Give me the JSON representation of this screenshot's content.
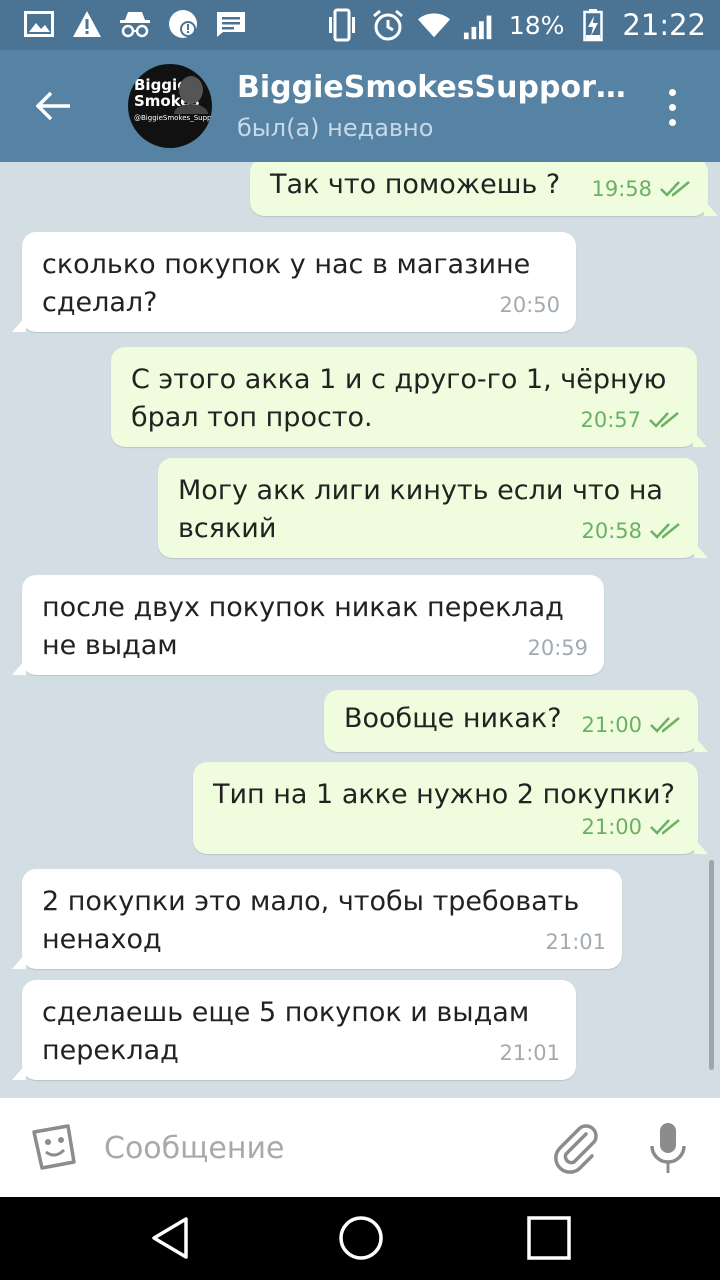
{
  "status_bar": {
    "battery": "18%",
    "time": "21:22",
    "icons": [
      "image-icon",
      "warning-icon",
      "incognito-icon",
      "sync-alert-icon",
      "message-icon",
      "vibrate-icon",
      "alarm-icon",
      "wifi-icon",
      "signal-icon",
      "battery-charging-icon"
    ]
  },
  "header": {
    "title": "BiggieSmokesSupport…",
    "status": "был(а) недавно",
    "avatar": {
      "line1": "Biggie",
      "line2": "Smokes",
      "line3": "@BiggieSmokes_Support"
    },
    "back_icon": "arrow-left-icon",
    "menu_icon": "more-vertical-icon"
  },
  "messages": [
    {
      "dir": "out",
      "text": "Так что поможешь ?",
      "time": "19:58",
      "read": true
    },
    {
      "dir": "in",
      "text": "сколько покупок у нас в магазине сделал?",
      "time": "20:50"
    },
    {
      "dir": "out",
      "text": "С этого акка 1 и с друго-го 1, чёрную брал топ просто.",
      "time": "20:57",
      "read": true
    },
    {
      "dir": "out",
      "text": "Могу акк лиги кинуть если что на всякий",
      "time": "20:58",
      "read": true
    },
    {
      "dir": "in",
      "text": "после двух покупок никак переклад не выдам",
      "time": "20:59"
    },
    {
      "dir": "out",
      "text": "Вообще никак?",
      "time": "21:00",
      "read": true
    },
    {
      "dir": "out",
      "text": "Тип на 1 акке нужно 2 покупки?",
      "time": "21:00",
      "read": true
    },
    {
      "dir": "in",
      "text": "2 покупки это мало, чтобы требовать ненаход",
      "time": "21:01"
    },
    {
      "dir": "in",
      "text": "сделаешь еще 5 покупок и выдам переклад",
      "time": "21:01"
    }
  ],
  "input": {
    "placeholder": "Сообщение",
    "value": ""
  },
  "colors": {
    "status_bar": "#4a7394",
    "header": "#5682a3",
    "outgoing_bubble": "#effdde",
    "incoming_bubble": "#ffffff",
    "chat_background": "#d2dee3",
    "read_check": "#6cb063"
  }
}
